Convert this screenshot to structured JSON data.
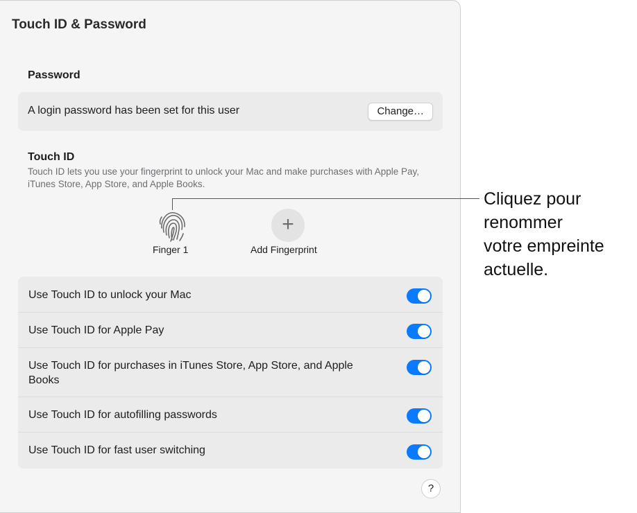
{
  "window": {
    "title": "Touch ID & Password"
  },
  "password": {
    "heading": "Password",
    "status_text": "A login password has been set for this user",
    "change_button": "Change…"
  },
  "touch_id": {
    "heading": "Touch ID",
    "description": "Touch ID lets you use your fingerprint to unlock your Mac and make purchases with Apple Pay, iTunes Store, App Store, and Apple Books.",
    "fingerprints": [
      {
        "label": "Finger 1",
        "icon": "fingerprint-icon"
      }
    ],
    "add_fingerprint": {
      "label": "Add Fingerprint",
      "icon": "plus-icon",
      "glyph": "+"
    }
  },
  "settings": [
    {
      "label": "Use Touch ID to unlock your Mac",
      "enabled": true
    },
    {
      "label": "Use Touch ID for Apple Pay",
      "enabled": true
    },
    {
      "label": "Use Touch ID for purchases in iTunes Store, App Store, and Apple Books",
      "enabled": true
    },
    {
      "label": "Use Touch ID for autofilling passwords",
      "enabled": true
    },
    {
      "label": "Use Touch ID for fast user switching",
      "enabled": true
    }
  ],
  "help": {
    "glyph": "?"
  },
  "callout": {
    "lines": [
      "Cliquez pour",
      "renommer",
      "votre empreinte",
      "actuelle."
    ]
  },
  "colors": {
    "accent": "#0a7aff",
    "panel_background": "#f5f5f5",
    "card_background": "#ebebeb"
  }
}
